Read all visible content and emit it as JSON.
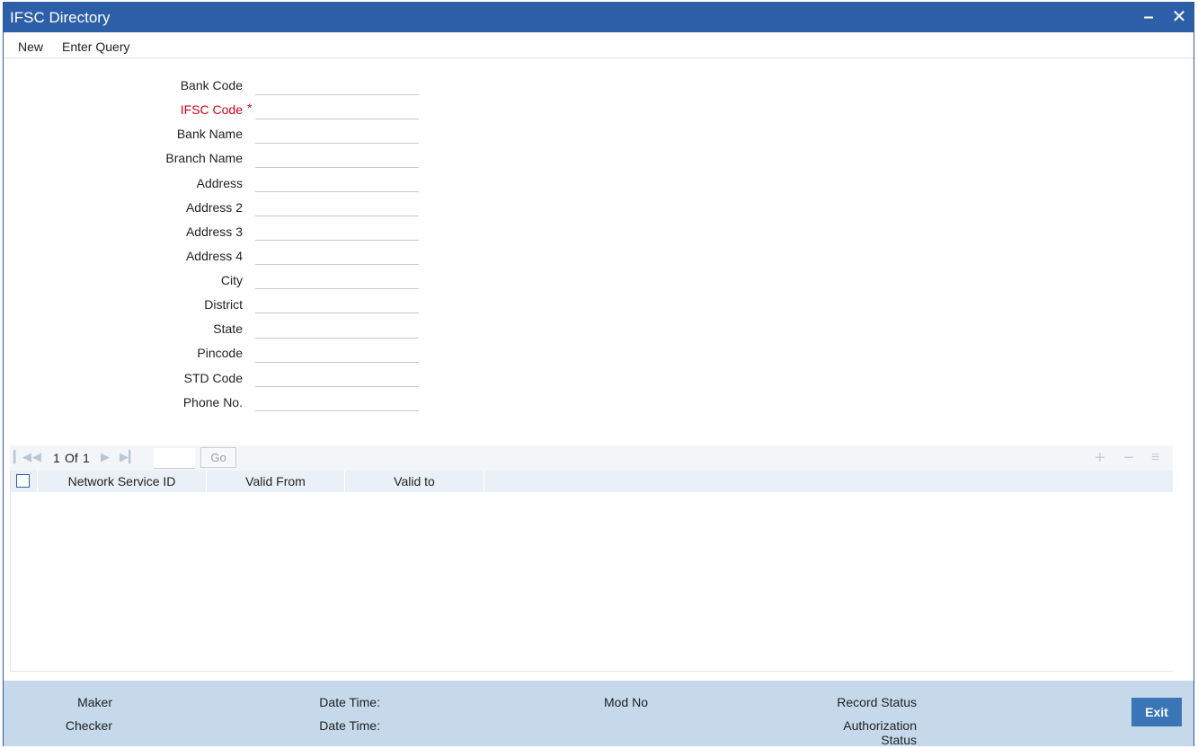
{
  "window": {
    "title": "IFSC Directory"
  },
  "menu": {
    "new_label": "New",
    "enter_query_label": "Enter Query"
  },
  "form": {
    "fields": [
      {
        "label": "Bank Code",
        "value": "",
        "required": false
      },
      {
        "label": "IFSC Code",
        "value": "",
        "required": true
      },
      {
        "label": "Bank Name",
        "value": "",
        "required": false
      },
      {
        "label": "Branch Name",
        "value": "",
        "required": false
      },
      {
        "label": "Address",
        "value": "",
        "required": false
      },
      {
        "label": "Address 2",
        "value": "",
        "required": false
      },
      {
        "label": "Address 3",
        "value": "",
        "required": false
      },
      {
        "label": "Address 4",
        "value": "",
        "required": false
      },
      {
        "label": "City",
        "value": "",
        "required": false
      },
      {
        "label": "District",
        "value": "",
        "required": false
      },
      {
        "label": "State",
        "value": "",
        "required": false
      },
      {
        "label": "Pincode",
        "value": "",
        "required": false
      },
      {
        "label": "STD Code",
        "value": "",
        "required": false
      },
      {
        "label": "Phone No.",
        "value": "",
        "required": false
      }
    ],
    "required_marker": "*"
  },
  "pagination": {
    "current": "1",
    "of_label": "Of",
    "total": "1",
    "go_label": "Go"
  },
  "grid": {
    "columns": [
      "Network Service ID",
      "Valid From",
      "Valid to"
    ],
    "rows": []
  },
  "footer": {
    "maker_label": "Maker",
    "checker_label": "Checker",
    "date_time_label_1": "Date Time:",
    "date_time_label_2": "Date Time:",
    "mod_no_label": "Mod No",
    "record_status_label": "Record Status",
    "authorization_label": "Authorization",
    "status_label": "Status",
    "exit_label": "Exit"
  },
  "colors": {
    "title_bar": "#2d5fa8",
    "footer_bg": "#c5d9ea",
    "required_text": "#d0021b",
    "exit_button": "#3a75b8"
  }
}
